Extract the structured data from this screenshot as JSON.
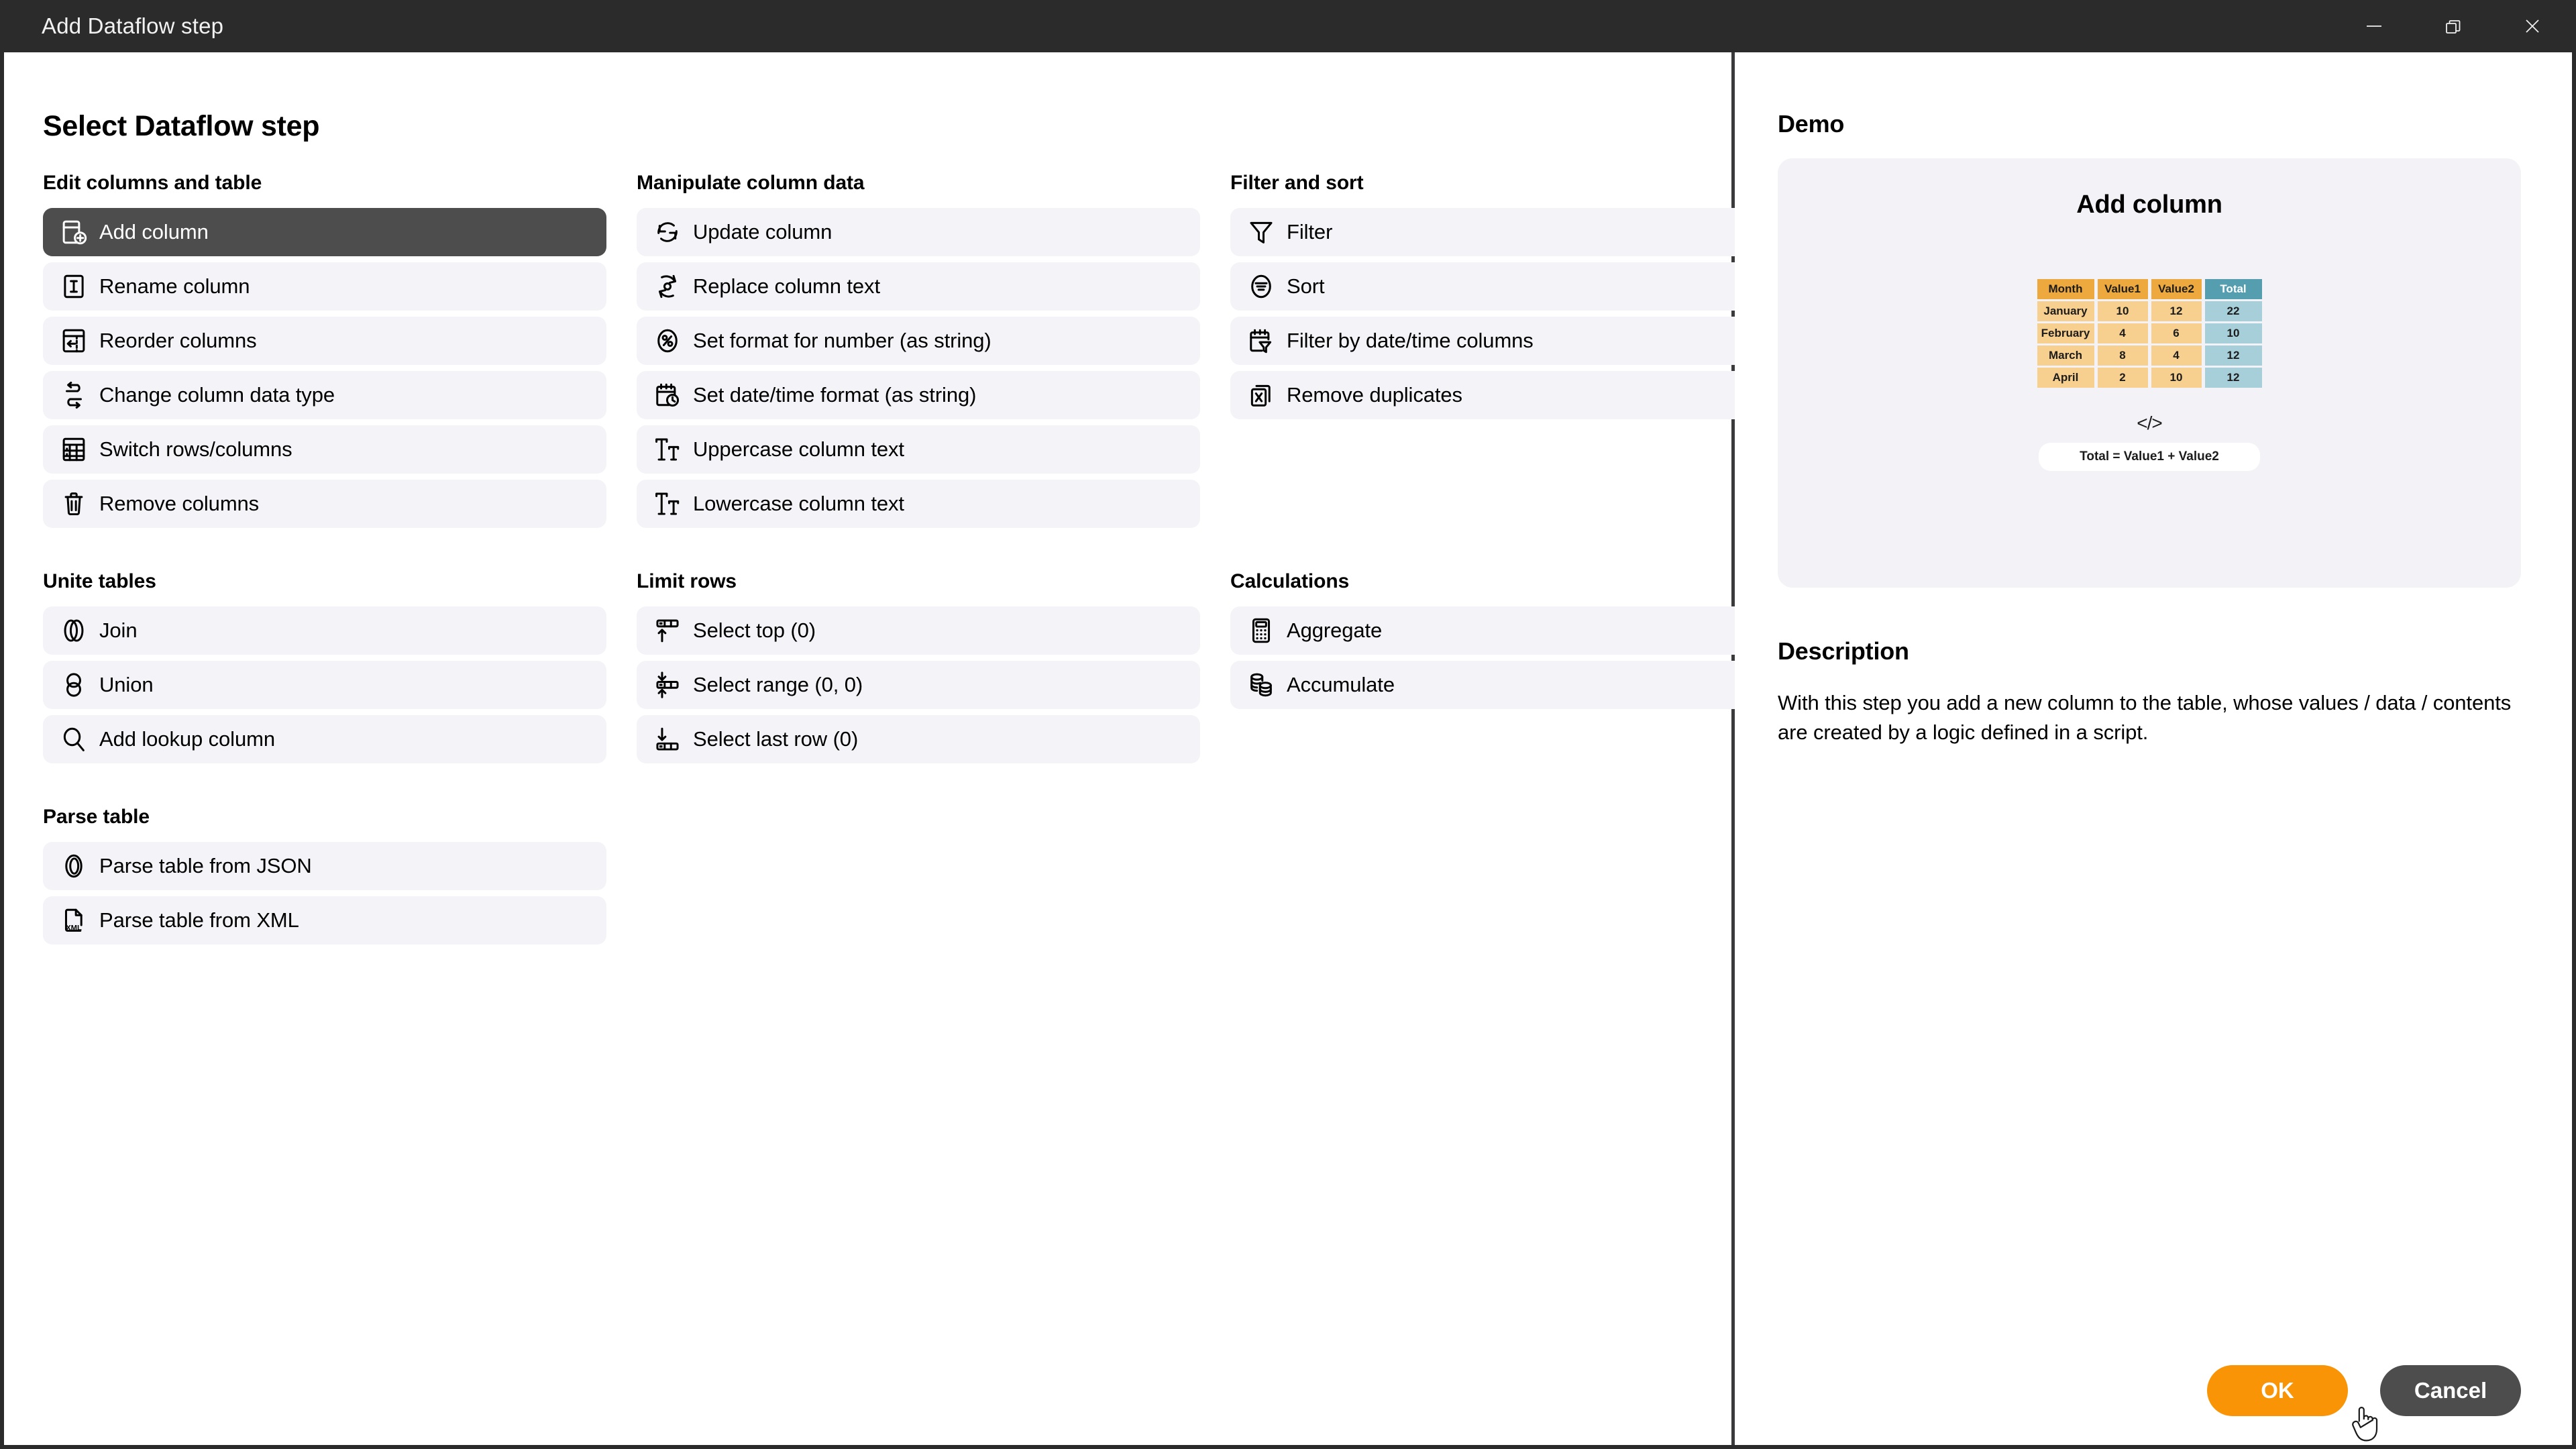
{
  "window": {
    "title": "Add Dataflow step",
    "controls": [
      {
        "name": "minimize",
        "label": "Minimize"
      },
      {
        "name": "restore",
        "label": "Restore"
      },
      {
        "name": "close",
        "label": "Close"
      }
    ]
  },
  "left": {
    "page_title": "Select Dataflow step",
    "groups": [
      {
        "title": "Edit columns and table",
        "items": [
          {
            "label": "Add column",
            "icon": "add-column-icon",
            "selected": true
          },
          {
            "label": "Rename column",
            "icon": "rename-column-icon",
            "selected": false
          },
          {
            "label": "Reorder columns",
            "icon": "reorder-columns-icon",
            "selected": false
          },
          {
            "label": "Change column data type",
            "icon": "change-data-type-icon",
            "selected": false
          },
          {
            "label": "Switch rows/columns",
            "icon": "switch-rows-columns-icon",
            "selected": false
          },
          {
            "label": "Remove columns",
            "icon": "trash-icon",
            "selected": false
          }
        ]
      },
      {
        "title": "Manipulate column data",
        "items": [
          {
            "label": "Update column",
            "icon": "refresh-icon",
            "selected": false
          },
          {
            "label": "Replace column text",
            "icon": "replace-text-icon",
            "selected": false
          },
          {
            "label": "Set format for number (as string)",
            "icon": "percent-circle-icon",
            "selected": false
          },
          {
            "label": "Set date/time format (as string)",
            "icon": "calendar-clock-icon",
            "selected": false
          },
          {
            "label": "Uppercase column text",
            "icon": "uppercase-icon",
            "selected": false
          },
          {
            "label": "Lowercase column text",
            "icon": "lowercase-icon",
            "selected": false
          }
        ]
      },
      {
        "title": "Filter and sort",
        "items": [
          {
            "label": "Filter",
            "icon": "funnel-icon",
            "selected": false
          },
          {
            "label": "Sort",
            "icon": "sort-circle-icon",
            "selected": false
          },
          {
            "label": "Filter by date/time columns",
            "icon": "calendar-funnel-icon",
            "selected": false
          },
          {
            "label": "Remove duplicates",
            "icon": "remove-duplicates-icon",
            "selected": false
          }
        ]
      },
      {
        "title": "Unite tables",
        "items": [
          {
            "label": "Join",
            "icon": "join-icon",
            "selected": false
          },
          {
            "label": "Union",
            "icon": "union-icon",
            "selected": false
          },
          {
            "label": "Add lookup column",
            "icon": "magnifier-icon",
            "selected": false
          }
        ]
      },
      {
        "title": "Limit rows",
        "items": [
          {
            "label": "Select top (0)",
            "icon": "select-top-icon",
            "selected": false
          },
          {
            "label": "Select range (0, 0)",
            "icon": "select-range-icon",
            "selected": false
          },
          {
            "label": "Select last row (0)",
            "icon": "select-last-row-icon",
            "selected": false
          }
        ]
      },
      {
        "title": "Calculations",
        "items": [
          {
            "label": "Aggregate",
            "icon": "calculator-icon",
            "selected": false
          },
          {
            "label": "Accumulate",
            "icon": "stack-icon",
            "selected": false
          }
        ]
      },
      {
        "title": "Parse table",
        "items": [
          {
            "label": "Parse table from JSON",
            "icon": "json-icon",
            "selected": false
          },
          {
            "label": "Parse table from XML",
            "icon": "xml-file-icon",
            "selected": false
          }
        ]
      }
    ]
  },
  "right": {
    "demo_title": "Demo",
    "demo_card_title": "Add column",
    "code_glyph": "</>",
    "formula": "Total = Value1 + Value2",
    "description_title": "Description",
    "description_text": "With this step you add a new column to the table, whose values / data / contents are created by a logic defined in a script.",
    "demo_table": {
      "headers": [
        "Month",
        "Value1",
        "Value2",
        "Total"
      ],
      "rows": [
        [
          "January",
          "10",
          "12",
          "22"
        ],
        [
          "February",
          "4",
          "6",
          "10"
        ],
        [
          "March",
          "8",
          "4",
          "12"
        ],
        [
          "April",
          "2",
          "10",
          "12"
        ]
      ]
    }
  },
  "footer": {
    "ok_label": "OK",
    "cancel_label": "Cancel"
  },
  "colors": {
    "titlebar": "#2b2b2b",
    "selected_item": "#4d4d4d",
    "item_bg": "#f3f3f8",
    "accent_orange": "#f89406",
    "demo_card_bg": "#f2f2f7",
    "table_header_orange": "#eda93e",
    "table_header_teal": "#549eb0",
    "table_body_orange": "#f7cf8e",
    "table_body_teal": "#a6cfda"
  }
}
